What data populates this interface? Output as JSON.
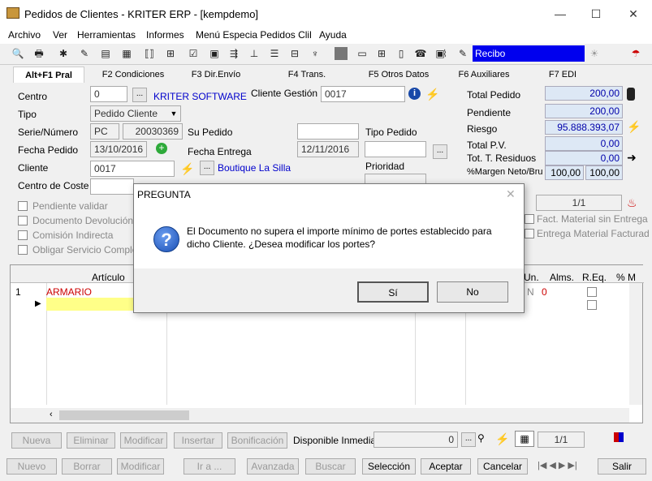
{
  "window": {
    "title": "Pedidos de Clientes - KRITER ERP - [kempdemo]",
    "minimize": "—",
    "maximize": "☐",
    "close": "✕"
  },
  "menu": [
    "Archivo",
    "Ver",
    "Herramientas",
    "Informes",
    "Menú Especia Pedidos Clil",
    "Ayuda"
  ],
  "toolbar": {
    "recibo": "Recibo"
  },
  "tabs": [
    "Alt+F1 Pral",
    "F2 Condiciones",
    "F3 Dir.Envío",
    "F4 Trans.",
    "F5 Otros Datos",
    "F6 Auxiliares",
    "F7 EDI"
  ],
  "form": {
    "centro_label": "Centro",
    "centro_value": "0",
    "centro_name": "KRITER SOFTWARE",
    "cliente_gestion_label": "Cliente Gestión",
    "cliente_gestion_value": "0017",
    "tipo_label": "Tipo",
    "tipo_value": "Pedido Cliente",
    "serie_label": "Serie/Número",
    "serie_value": "PC",
    "numero_value": "20030369",
    "su_pedido_label": "Su Pedido",
    "tipo_pedido_label": "Tipo Pedido",
    "fecha_pedido_label": "Fecha Pedido",
    "fecha_pedido_value": "13/10/2016",
    "fecha_entrega_label": "Fecha Entrega",
    "fecha_entrega_value": "12/11/2016",
    "cliente_label": "Cliente",
    "cliente_value": "0017",
    "cliente_name": "Boutique La Silla",
    "prioridad_label": "Prioridad",
    "centro_coste_label": "Centro de Coste"
  },
  "totals": {
    "total_pedido_label": "Total Pedido",
    "total_pedido": "200,00",
    "pendiente_label": "Pendiente",
    "pendiente": "200,00",
    "riesgo_label": "Riesgo",
    "riesgo": "95.888.393,07",
    "total_pv_label": "Total P.V.",
    "total_pv": "0,00",
    "residuos_label": "Tot. T. Residuos",
    "residuos": "0,00",
    "margen_label": "%Margen Neto/Bru",
    "margen_neto": "100,00",
    "margen_bruto": "100,00",
    "page": "1/1"
  },
  "checks": {
    "pendiente_validar": "Pendiente validar",
    "documento_devolucion": "Documento Devolución",
    "comision_indirecta": "Comisión Indirecta",
    "obligar_servicio": "Obligar Servicio Completo",
    "fact_material": "Fact. Material sin Entrega",
    "entrega_material": "Entrega Material Facturad"
  },
  "grid": {
    "col_articulo": "Artículo",
    "col_un": "Un.",
    "col_alms": "Alms.",
    "col_req": "R.Eq.",
    "col_pct": "% M",
    "row1_num": "1",
    "row1_articulo": "ARMARIO",
    "row1_un": "N",
    "row1_alms": "0"
  },
  "bottom1": {
    "nueva": "Nueva",
    "eliminar": "Eliminar",
    "modificar": "Modificar",
    "insertar": "Insertar",
    "bonificacion": "Bonificación",
    "disponible_label": "Disponible Inmediato",
    "disponible_value": "0",
    "page": "1/1"
  },
  "bottom2": {
    "nuevo": "Nuevo",
    "borrar": "Borrar",
    "modificar": "Modificar",
    "ira": "Ir a ...",
    "avanzada": "Avanzada",
    "buscar": "Buscar",
    "seleccion": "Selección",
    "aceptar": "Aceptar",
    "cancelar": "Cancelar",
    "salir": "Salir"
  },
  "dialog": {
    "title": "PREGUNTA",
    "message": "El Documento no supera el importe mínimo de portes establecido para dicho Cliente. ¿Desea modificar los portes?",
    "yes": "Sí",
    "no": "No"
  }
}
